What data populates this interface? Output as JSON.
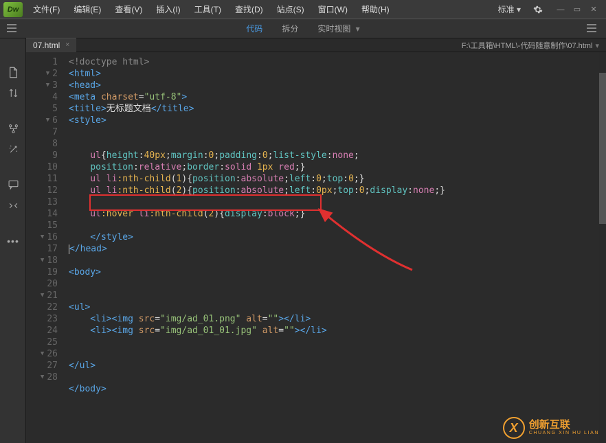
{
  "app": {
    "logo_text": "Dw"
  },
  "menu": {
    "items": [
      "文件(F)",
      "编辑(E)",
      "查看(V)",
      "插入(I)",
      "工具(T)",
      "查找(D)",
      "站点(S)",
      "窗口(W)",
      "帮助(H)"
    ]
  },
  "title_right": {
    "workspace": "标准 ▾"
  },
  "view_tabs": {
    "code": "代码",
    "split": "拆分",
    "live": "实时视图"
  },
  "tab": {
    "name": "07.html",
    "close": "×"
  },
  "breadcrumb": "F:\\工具箱\\HTML\\-代码随意制作\\07.html",
  "watermark": {
    "cn": "创新互联",
    "en": "CHUANG XIN HU LIAN"
  },
  "gutter": {
    "start": 1,
    "end": 28,
    "folds": [
      2,
      3,
      6,
      16,
      18,
      21,
      26,
      28
    ]
  },
  "code_lines": [
    [
      [
        "c-gray",
        "<!doctype html>"
      ]
    ],
    [
      [
        "c-blue",
        "<html>"
      ]
    ],
    [
      [
        "c-blue",
        "<head>"
      ]
    ],
    [
      [
        "c-blue",
        "<meta"
      ],
      [
        "c-white",
        " "
      ],
      [
        "c-orange",
        "charset"
      ],
      [
        "c-white",
        "="
      ],
      [
        "c-green",
        "\"utf-8\""
      ],
      [
        "c-blue",
        ">"
      ]
    ],
    [
      [
        "c-blue",
        "<title>"
      ],
      [
        "c-white",
        "无标题文档"
      ],
      [
        "c-blue",
        "</title>"
      ]
    ],
    [
      [
        "c-blue",
        "<style>"
      ]
    ],
    [],
    [],
    [
      [
        "c-pink",
        "    ul"
      ],
      [
        "c-white",
        "{"
      ],
      [
        "c-aqua",
        "height"
      ],
      [
        "c-white",
        ":"
      ],
      [
        "c-yellow",
        "40px"
      ],
      [
        "c-white",
        ";"
      ],
      [
        "c-aqua",
        "margin"
      ],
      [
        "c-white",
        ":"
      ],
      [
        "c-yellow",
        "0"
      ],
      [
        "c-white",
        ";"
      ],
      [
        "c-aqua",
        "padding"
      ],
      [
        "c-white",
        ":"
      ],
      [
        "c-yellow",
        "0"
      ],
      [
        "c-white",
        ";"
      ],
      [
        "c-aqua",
        "list-style"
      ],
      [
        "c-white",
        ":"
      ],
      [
        "c-pink",
        "none"
      ],
      [
        "c-white",
        ";"
      ]
    ],
    [
      [
        "c-white",
        "    "
      ],
      [
        "c-aqua",
        "position"
      ],
      [
        "c-white",
        ":"
      ],
      [
        "c-pink",
        "relative"
      ],
      [
        "c-white",
        ";"
      ],
      [
        "c-aqua",
        "border"
      ],
      [
        "c-white",
        ":"
      ],
      [
        "c-pink",
        "solid"
      ],
      [
        "c-white",
        " "
      ],
      [
        "c-yellow",
        "1px"
      ],
      [
        "c-white",
        " "
      ],
      [
        "c-pink",
        "red"
      ],
      [
        "c-white",
        ";}"
      ]
    ],
    [
      [
        "c-pink",
        "    ul li"
      ],
      [
        "c-yellow",
        ":nth-child"
      ],
      [
        "c-white",
        "("
      ],
      [
        "c-yellow",
        "1"
      ],
      [
        "c-white",
        "){"
      ],
      [
        "c-aqua",
        "position"
      ],
      [
        "c-white",
        ":"
      ],
      [
        "c-pink",
        "absolute"
      ],
      [
        "c-white",
        ";"
      ],
      [
        "c-aqua",
        "left"
      ],
      [
        "c-white",
        ":"
      ],
      [
        "c-yellow",
        "0"
      ],
      [
        "c-white",
        ";"
      ],
      [
        "c-aqua",
        "top"
      ],
      [
        "c-white",
        ":"
      ],
      [
        "c-yellow",
        "0"
      ],
      [
        "c-white",
        ";}"
      ]
    ],
    [
      [
        "c-pink",
        "    ul li"
      ],
      [
        "c-yellow",
        ":nth-child"
      ],
      [
        "c-white",
        "("
      ],
      [
        "c-yellow",
        "2"
      ],
      [
        "c-white",
        "){"
      ],
      [
        "c-aqua",
        "position"
      ],
      [
        "c-white",
        ":"
      ],
      [
        "c-pink",
        "absolute"
      ],
      [
        "c-white",
        ";"
      ],
      [
        "c-aqua",
        "left"
      ],
      [
        "c-white",
        ":"
      ],
      [
        "c-yellow",
        "0px"
      ],
      [
        "c-white",
        ";"
      ],
      [
        "c-aqua",
        "top"
      ],
      [
        "c-white",
        ":"
      ],
      [
        "c-yellow",
        "0"
      ],
      [
        "c-white",
        ";"
      ],
      [
        "c-aqua",
        "display"
      ],
      [
        "c-white",
        ":"
      ],
      [
        "c-pink",
        "none"
      ],
      [
        "c-white",
        ";}"
      ]
    ],
    [],
    [
      [
        "c-pink",
        "    ul"
      ],
      [
        "c-yellow",
        ":hover"
      ],
      [
        "c-pink",
        " li"
      ],
      [
        "c-yellow",
        ":nth-child"
      ],
      [
        "c-white",
        "("
      ],
      [
        "c-yellow",
        "2"
      ],
      [
        "c-white",
        "){"
      ],
      [
        "c-aqua",
        "display"
      ],
      [
        "c-white",
        ":"
      ],
      [
        "c-pink",
        "block"
      ],
      [
        "c-white",
        ";}"
      ]
    ],
    [],
    [
      [
        "c-blue",
        "    </style>"
      ]
    ],
    [
      [
        "c-blue",
        "</head>"
      ]
    ],
    [],
    [
      [
        "c-blue",
        "<body>"
      ]
    ],
    [],
    [],
    [
      [
        "c-blue",
        "<ul>"
      ]
    ],
    [
      [
        "c-blue",
        "    <li><img"
      ],
      [
        "c-white",
        " "
      ],
      [
        "c-orange",
        "src"
      ],
      [
        "c-white",
        "="
      ],
      [
        "c-green",
        "\"img/ad_01.png\""
      ],
      [
        "c-white",
        " "
      ],
      [
        "c-orange",
        "alt"
      ],
      [
        "c-white",
        "="
      ],
      [
        "c-green",
        "\"\""
      ],
      [
        "c-blue",
        "></li>"
      ]
    ],
    [
      [
        "c-blue",
        "    <li><img"
      ],
      [
        "c-white",
        " "
      ],
      [
        "c-orange",
        "src"
      ],
      [
        "c-white",
        "="
      ],
      [
        "c-green",
        "\"img/ad_01_01.jpg\""
      ],
      [
        "c-white",
        " "
      ],
      [
        "c-orange",
        "alt"
      ],
      [
        "c-white",
        "="
      ],
      [
        "c-green",
        "\"\""
      ],
      [
        "c-blue",
        "></li>"
      ]
    ],
    [],
    [],
    [
      [
        "c-blue",
        "</ul>"
      ]
    ],
    [],
    [
      [
        "c-blue",
        "</body>"
      ]
    ]
  ],
  "cursor_line": 17
}
